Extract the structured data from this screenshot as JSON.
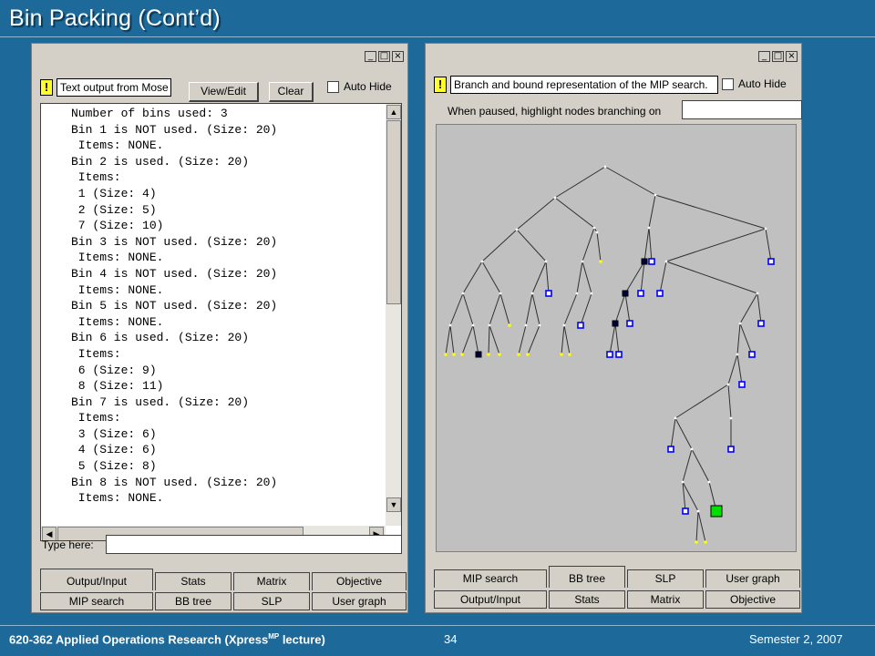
{
  "slide": {
    "title": "Bin Packing (Cont’d)",
    "footer_course": "620-362 Applied Operations Research (Xpress",
    "footer_sup": "MP",
    "footer_course_end": " lecture)",
    "page_number": "34",
    "semester": "Semester 2, 2007"
  },
  "left_window": {
    "minimize": "_",
    "maximize": "□",
    "close": "×",
    "title_field": "Text output from Mose",
    "view_edit_label": "View/Edit",
    "clear_label": "Clear",
    "auto_hide_label": "Auto Hide",
    "output_lines": [
      "Number of bins used: 3",
      "Bin 1 is NOT used. (Size: 20)",
      " Items: NONE.",
      "Bin 2 is used. (Size: 20)",
      " Items:",
      " 1 (Size: 4)",
      " 2 (Size: 5)",
      " 7 (Size: 10)",
      "Bin 3 is NOT used. (Size: 20)",
      " Items: NONE.",
      "Bin 4 is NOT used. (Size: 20)",
      " Items: NONE.",
      "Bin 5 is NOT used. (Size: 20)",
      " Items: NONE.",
      "Bin 6 is used. (Size: 20)",
      " Items:",
      " 6 (Size: 9)",
      " 8 (Size: 11)",
      "Bin 7 is used. (Size: 20)",
      " Items:",
      " 3 (Size: 6)",
      " 4 (Size: 6)",
      " 5 (Size: 8)",
      "Bin 8 is NOT used. (Size: 20)",
      " Items: NONE."
    ],
    "type_here_label": "Type here:",
    "type_here_value": "",
    "tabs_row1": [
      "Output/Input",
      "Stats",
      "Matrix",
      "Objective"
    ],
    "tabs_row2": [
      "MIP search",
      "BB tree",
      "SLP",
      "User graph"
    ],
    "active_tab": "Output/Input"
  },
  "right_window": {
    "minimize": "_",
    "maximize": "□",
    "close": "×",
    "title_field": "Branch and bound representation of the MIP search.",
    "auto_hide_label": "Auto Hide",
    "highlight_label": "When paused, highlight nodes branching on",
    "highlight_value": "",
    "tabs_row1": [
      "MIP search",
      "BB tree",
      "SLP",
      "User graph"
    ],
    "tabs_row2": [
      "Output/Input",
      "Stats",
      "Matrix",
      "Objective"
    ],
    "active_tab": "BB tree"
  },
  "colors": {
    "slide_bg": "#1d6a9a",
    "tree_bg": "#c0c0c0",
    "edge": "#ffffff",
    "node_open": "#ffff00",
    "node_integer": "#0000ff",
    "node_infeasible": "#000040",
    "node_best": "#00e000"
  }
}
